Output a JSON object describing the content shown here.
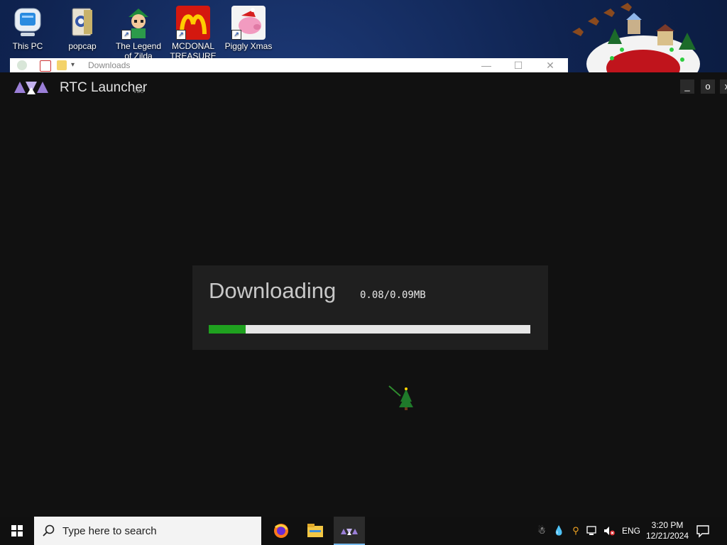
{
  "desktop": {
    "icons": [
      {
        "label": "This PC"
      },
      {
        "label": "popcap"
      },
      {
        "label": "The Legend of Zilda"
      },
      {
        "label": "MCDONAL TREASURE"
      },
      {
        "label": "Piggly Xmas"
      }
    ]
  },
  "explorer": {
    "title": "Downloads",
    "minimize_glyph": "—",
    "maximize_glyph": "☐",
    "close_glyph": "✕"
  },
  "launcher": {
    "title": "RTC Launcher",
    "version": "v36",
    "minimize_glyph": "_",
    "maximize_glyph": "o",
    "close_glyph": "x",
    "download": {
      "heading": "Downloading",
      "size_text": "0.08/0.09MB",
      "progress_fraction": 0.115,
      "progress_color": "#1fa11f"
    }
  },
  "taskbar": {
    "search_placeholder": "Type here to search",
    "language": "ENG",
    "time": "3:20 PM",
    "date": "12/21/2024",
    "icons": [
      "windows-start-icon",
      "search-icon",
      "firefox-icon",
      "file-explorer-icon",
      "rtc-launcher-icon",
      "network-icon",
      "volume-muted-icon",
      "notification-icon"
    ]
  },
  "colors": {
    "launcher_bg": "#111111",
    "panel_bg": "#1f1f1f",
    "accent_purple": "#9b7fd8"
  }
}
